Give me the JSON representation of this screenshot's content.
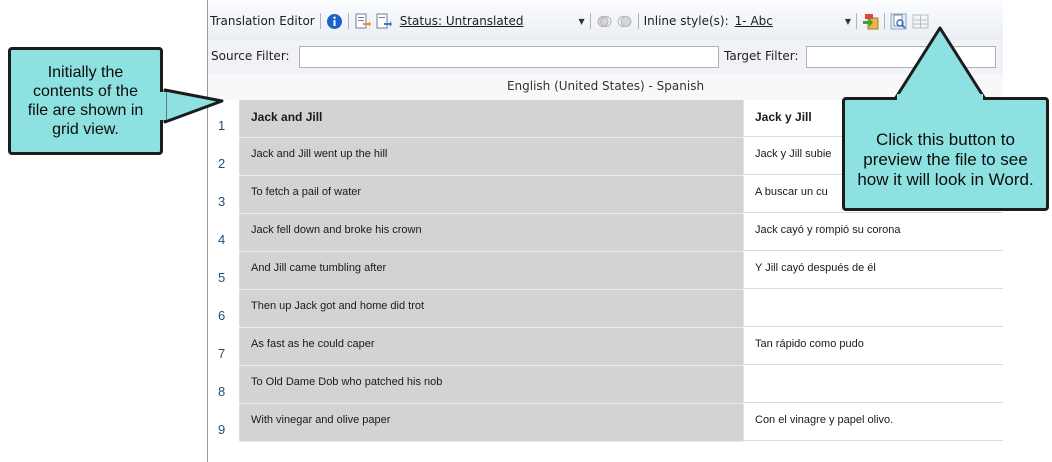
{
  "toolbar": {
    "title": "Translation Editor",
    "status_label": "Status: Untranslated",
    "inline_style_prefix": "Inline style(s):",
    "inline_style_value": "1- Abc"
  },
  "filters": {
    "source_label": "Source Filter:",
    "target_label": "Target Filter:"
  },
  "grid": {
    "language_header": "English (United States) - Spanish",
    "rows": [
      {
        "num": "1",
        "source": "Jack and Jill",
        "target": "Jack y Jill"
      },
      {
        "num": "2",
        "source": "Jack and Jill went up the hill",
        "target": "Jack y Jill subie"
      },
      {
        "num": "3",
        "source": "To fetch a pail of water",
        "target": "A buscar un cu"
      },
      {
        "num": "4",
        "source": "Jack fell down and broke his crown",
        "target": "Jack cayó y rompió su corona"
      },
      {
        "num": "5",
        "source": "And Jill came tumbling after",
        "target": "Y Jill cayó después de él"
      },
      {
        "num": "6",
        "source": "Then up Jack got and home did trot",
        "target": ""
      },
      {
        "num": "7",
        "source": "As fast as he could caper",
        "target": "Tan rápido como pudo"
      },
      {
        "num": "8",
        "source": "To Old Dame Dob who patched his nob",
        "target": ""
      },
      {
        "num": "9",
        "source": "With vinegar and olive paper",
        "target": "Con el vinagre y papel olivo."
      }
    ]
  },
  "callouts": {
    "left": [
      "Initially the",
      "contents of the",
      "file are shown in",
      "grid view."
    ],
    "right": [
      "Click this button to",
      "preview the file to see",
      "how it will look in Word."
    ]
  },
  "icons": [
    "info-icon",
    "export-icon",
    "import-icon",
    "toggle-left-icon",
    "toggle-right-icon",
    "translate-icon",
    "preview-icon",
    "grid-view-icon"
  ],
  "colors": {
    "callout_fill": "#8de1e1",
    "source_cell": "#d3d3d3"
  }
}
